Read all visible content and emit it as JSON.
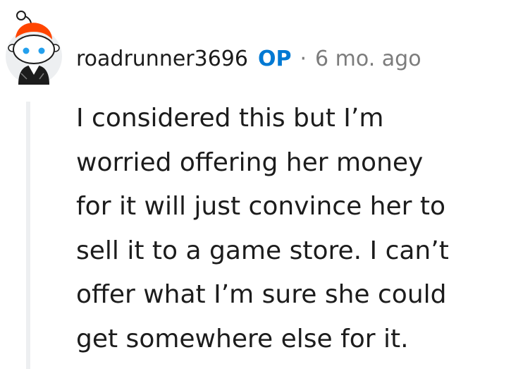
{
  "comment": {
    "author": "roadrunner3696",
    "badge": "OP",
    "separator": "·",
    "timestamp": "6 mo. ago",
    "body_lines": [
      "I considered this but I’m",
      "worried offering her money",
      "for it will just convince her to",
      "sell it to a game store. I can’t",
      "offer what I’m sure she could",
      "get somewhere else for it."
    ]
  },
  "avatar": {
    "icon": "snoo-avatar-icon",
    "hair_color": "#ff4500",
    "eye_color": "#24a0ed",
    "background_color": "#edeff1"
  },
  "colors": {
    "text": "#1c1c1c",
    "op_badge": "#0079d3",
    "meta": "#7c7c7c",
    "thread_line": "#edeff1"
  }
}
